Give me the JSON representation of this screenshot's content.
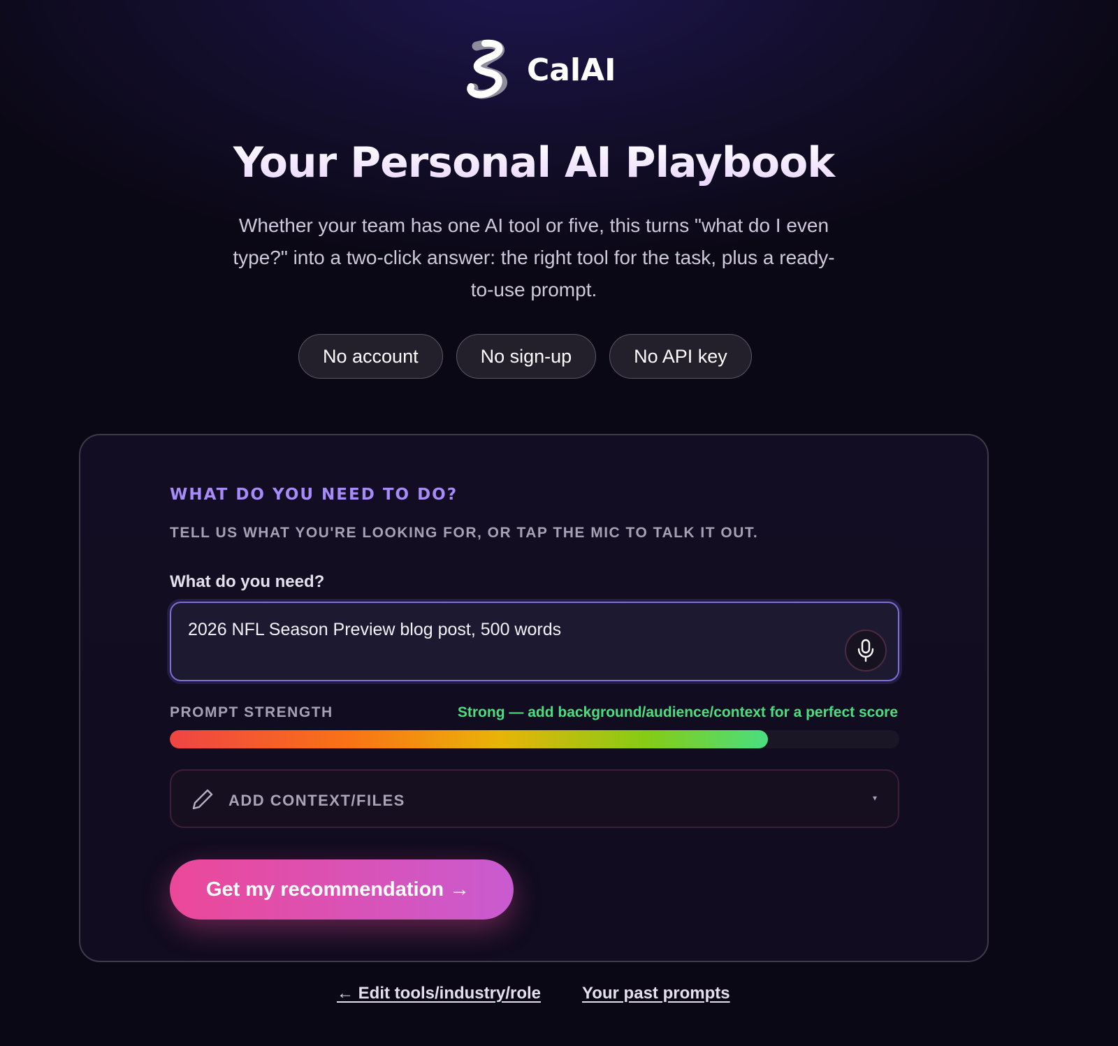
{
  "brand": {
    "name": "CalAI",
    "logo_icon": "calai-logo-icon"
  },
  "hero": {
    "title": "Your Personal AI Playbook",
    "subtitle": "Whether your team has one AI tool or five, this turns \"what do I even type?\" into a two-click answer: the right tool for the task, plus a ready-to-use prompt.",
    "badges": [
      "No account",
      "No sign-up",
      "No API key"
    ]
  },
  "card": {
    "title": "WHAT DO YOU NEED TO DO?",
    "subtitle": "TELL US WHAT YOU'RE LOOKING FOR, OR TAP THE MIC TO TALK IT OUT.",
    "field_label": "What do you need?",
    "field_value": "2026 NFL Season Preview blog post, 500 words",
    "mic_icon": "microphone-icon",
    "strength": {
      "label": "PROMPT STRENGTH",
      "status": "Strong — add background/audience/context for a perfect score",
      "status_color": "#4ade80",
      "value_fraction": 0.82
    },
    "context": {
      "label": "ADD CONTEXT/FILES",
      "icon": "pencil-icon",
      "caret": "▾"
    },
    "cta_label": "Get my recommendation →"
  },
  "footer": {
    "edit_link": "← Edit tools/industry/role",
    "history_link": "Your past prompts"
  },
  "colors": {
    "background": "#0b0816",
    "accent_purple": "#a78bfa",
    "cta_pink": "#ec4899",
    "cta_violet": "#c95bd0"
  }
}
